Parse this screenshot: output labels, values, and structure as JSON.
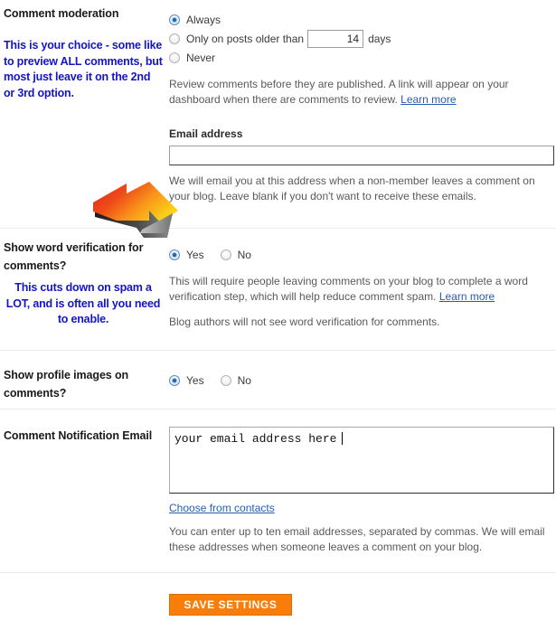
{
  "accent": {
    "note_blue": "#1414c8",
    "link_blue": "#2b5ab2",
    "save_orange": "#f97d09",
    "save_orange_border": "#e06c00",
    "radio_dot_blue": "#1f6ab5",
    "divider_gray": "#ececec",
    "arrow_red": "#e8231f",
    "arrow_orange": "#f9a21b",
    "arrow_yellow": "#fbd019"
  },
  "sections": {
    "comment_moderation": {
      "label": "Comment moderation",
      "note": "This is your choice - some like to preview ALL comments, but most just leave it on the 2nd or 3rd option.",
      "options": [
        {
          "label": "Always",
          "selected": true
        },
        {
          "label": "Only on posts older than",
          "selected": false,
          "suffix": "days",
          "value": "14"
        },
        {
          "label": "Never",
          "selected": false
        }
      ],
      "help": "Review comments before they are published. A link will appear on your dashboard when there are comments to review.",
      "help_link": "Learn more",
      "email_field_label": "Email address",
      "email_field_value": "",
      "email_field_placeholder": "",
      "email_help": "We will email you at this address when a non-member leaves a comment on your blog. Leave blank if you don't want to receive these emails."
    },
    "word_verification": {
      "label": "Show word verification for comments?",
      "note": "This cuts down on spam a LOT, and is often all you need to enable.",
      "options": [
        {
          "label": "Yes",
          "selected": true
        },
        {
          "label": "No",
          "selected": false
        }
      ],
      "help": "This will require people leaving comments on your blog to complete a word verification step, which will help reduce comment spam.",
      "help_link": "Learn more",
      "help2": "Blog authors will not see word verification for comments."
    },
    "profile_images": {
      "label": "Show profile images on comments?",
      "options": [
        {
          "label": "Yes",
          "selected": true
        },
        {
          "label": "No",
          "selected": false
        }
      ]
    },
    "notification_email": {
      "label": "Comment Notification Email",
      "textarea_value": "your email address here",
      "textarea_placeholder": "",
      "contacts_link": "Choose from contacts",
      "help": "You can enter up to ten email addresses, separated by commas. We will email these addresses when someone leaves a comment on your blog."
    }
  },
  "footer": {
    "save_label": "SAVE SETTINGS"
  },
  "annotations": {
    "arrow_name": "arrow-pointing-to-word-verification"
  }
}
